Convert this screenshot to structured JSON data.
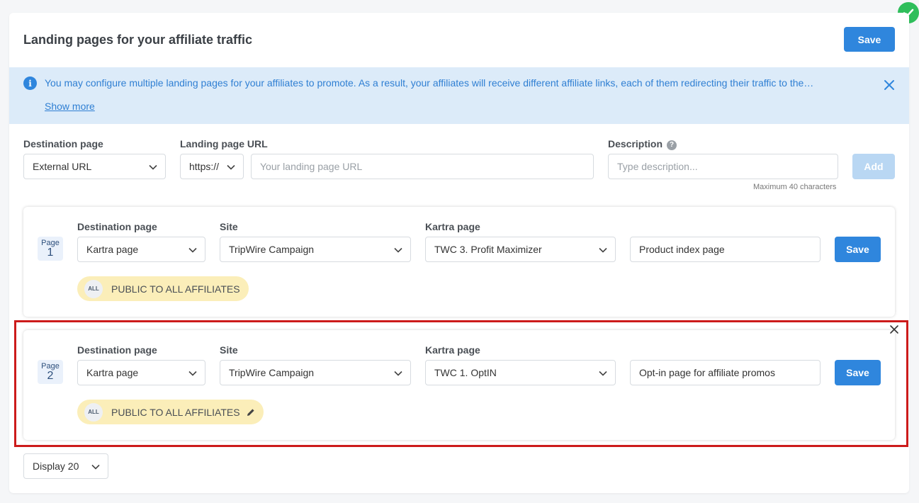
{
  "header": {
    "title": "Landing pages for your affiliate traffic",
    "save_label": "Save"
  },
  "info": {
    "icon": "info-icon",
    "text": "You may configure multiple landing pages for your affiliates to promote. As a result, your affiliates will receive different affiliate links, each of them redirecting their traffic to the…",
    "show_more": "Show more"
  },
  "form": {
    "destination_label": "Destination page",
    "destination_value": "External URL",
    "url_label": "Landing page URL",
    "protocol_value": "https://",
    "url_placeholder": "Your landing page URL",
    "description_label": "Description",
    "description_placeholder": "Type description...",
    "description_hint_icon": "?",
    "max_note": "Maximum 40 characters",
    "add_label": "Add"
  },
  "rows": [
    {
      "page_label": "Page",
      "page_number": "1",
      "destination_label": "Destination page",
      "destination_value": "Kartra page",
      "site_label": "Site",
      "site_value": "TripWire Campaign",
      "kartra_label": "Kartra page",
      "kartra_value": "TWC 3. Profit Maximizer",
      "description_value": "Product index page",
      "pill_avatar": "ALL",
      "pill_text": "PUBLIC TO ALL AFFILIATES",
      "save_label": "Save"
    },
    {
      "page_label": "Page",
      "page_number": "2",
      "destination_label": "Destination page",
      "destination_value": "Kartra page",
      "site_label": "Site",
      "site_value": "TripWire Campaign",
      "kartra_label": "Kartra page",
      "kartra_value": "TWC 1. OptIN",
      "description_value": "Opt-in page for affiliate promos",
      "pill_avatar": "ALL",
      "pill_text": "PUBLIC TO ALL AFFILIATES",
      "save_label": "Save"
    }
  ],
  "footer": {
    "display_value": "Display 20"
  },
  "colors": {
    "primary": "#2f86dd",
    "info_bg": "#dcebf9",
    "highlight": "#cc1b1b",
    "success": "#2fbe5b",
    "pill_bg": "#fbeeb9"
  }
}
